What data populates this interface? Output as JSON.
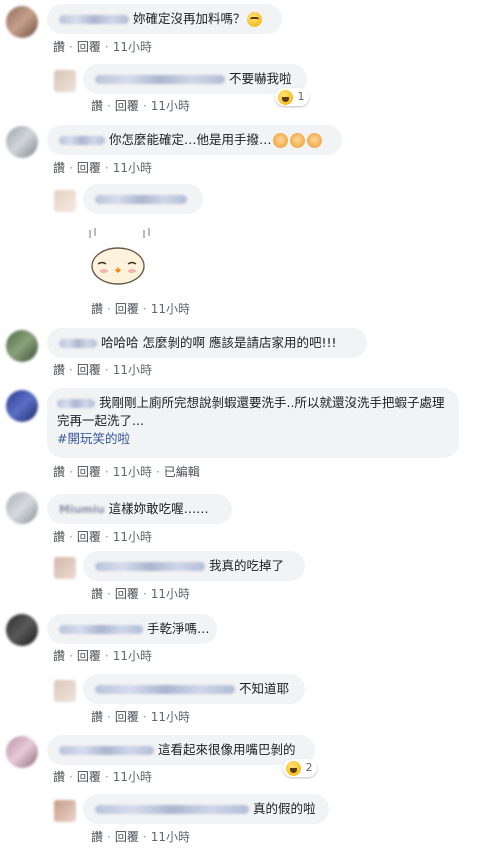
{
  "actions": {
    "like": "讚",
    "reply": "回覆",
    "dot": "·",
    "edited": "已編輯"
  },
  "comments": [
    {
      "text": "妳確定沒再加料嗎？",
      "time": "11小時"
    },
    {
      "text": "不要嚇我啦",
      "time": "11小時",
      "reaction_count": "1"
    },
    {
      "text": "你怎麼能確定…他是用手撥…",
      "time": "11小時"
    },
    {
      "time": "11小時"
    },
    {
      "text": "哈哈哈 怎麼剝的啊 應該是請店家用的吧!!!",
      "time": "11小時"
    },
    {
      "text": "我剛剛上廁所完想說剝蝦還要洗手..所以就還沒洗手把蝦子處理完再一起洗了...",
      "hashtag": "#開玩笑的啦",
      "time": "11小時"
    },
    {
      "name": "Miumiu",
      "text": "這樣妳敢吃喔……",
      "time": "11小時"
    },
    {
      "text": "我真的吃掉了",
      "time": "11小時"
    },
    {
      "text": "手乾淨嗎…",
      "time": "11小時"
    },
    {
      "text": "不知道耶",
      "time": "11小時"
    },
    {
      "text": "這看起來很像用嘴巴剝的",
      "time": "11小時",
      "reaction_count": "2"
    },
    {
      "text": "真的假的啦",
      "time": "11小時"
    }
  ],
  "colors": {
    "bubble": "#f2f3f5",
    "link": "#385898",
    "meta": "#616770"
  }
}
